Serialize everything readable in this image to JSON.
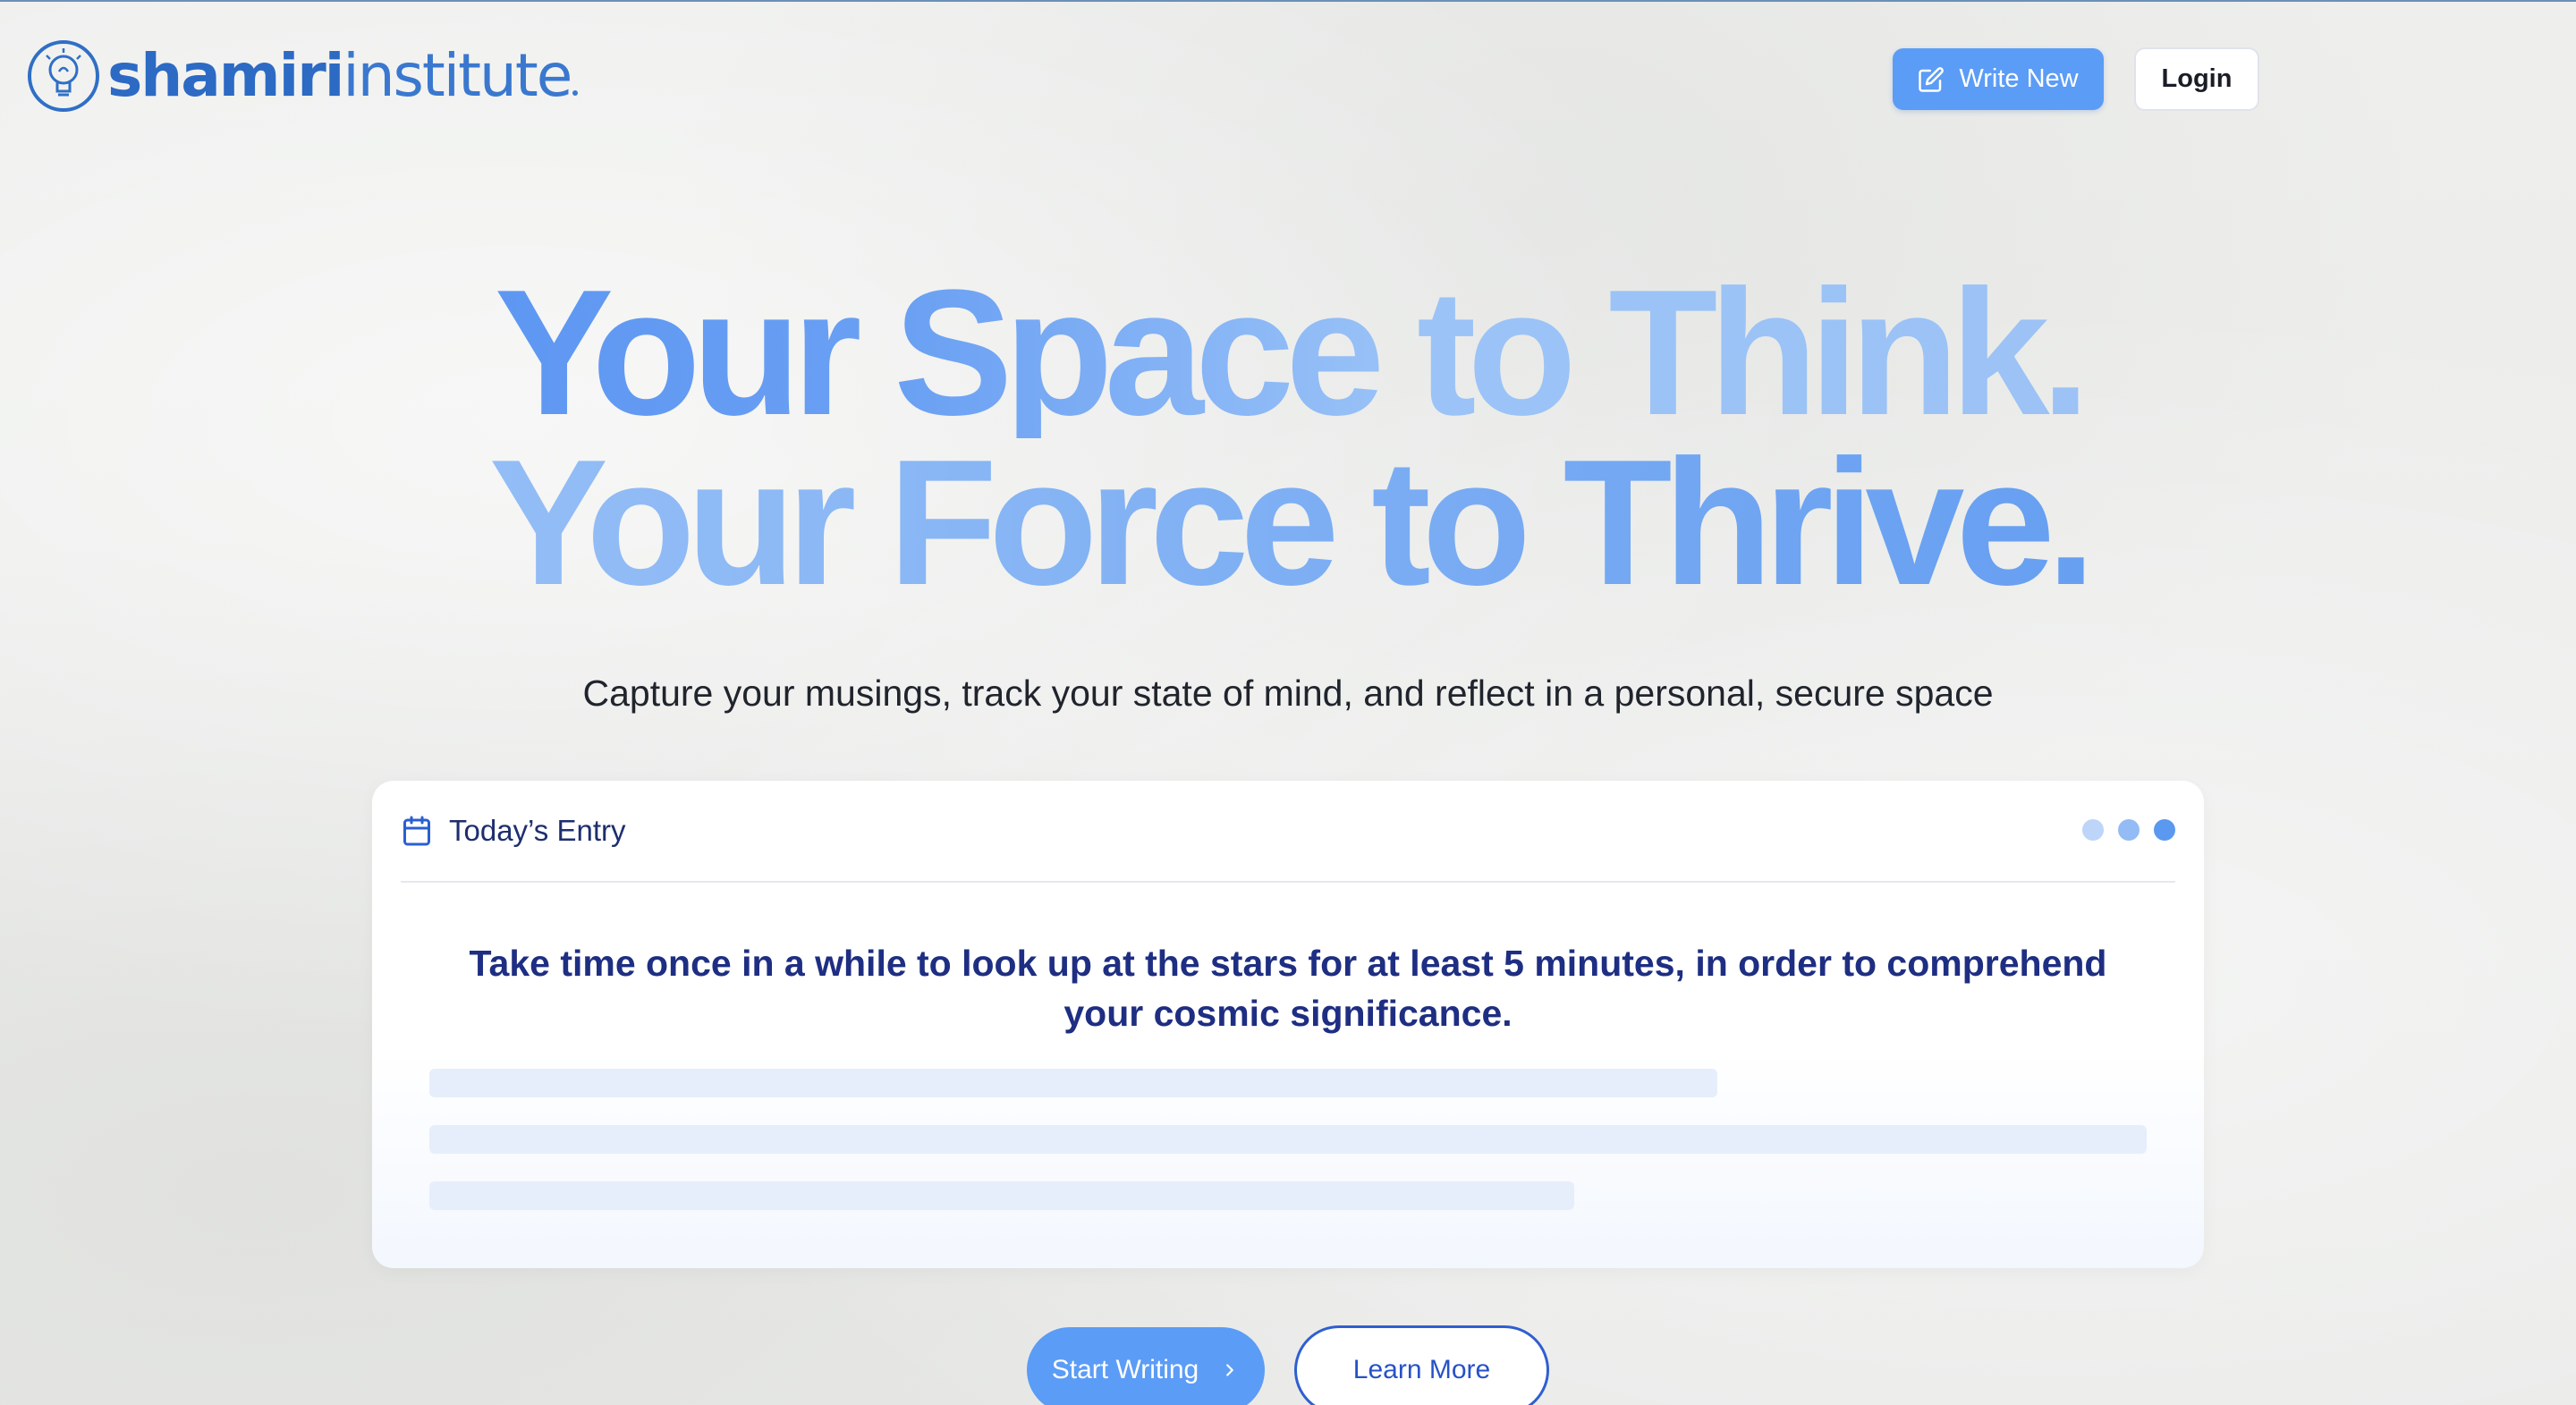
{
  "header": {
    "logo_bold": "shamiri",
    "logo_light": "institute",
    "write_new_label": "Write New",
    "login_label": "Login"
  },
  "hero": {
    "line1": "Your Space to Think.",
    "line2": "Your Force to Thrive.",
    "subtitle": "Capture your musings, track your state of mind, and reflect in a personal, secure space"
  },
  "entry_card": {
    "title": "Today’s Entry",
    "quote": "Take time once in a while to look up at the stars for at least 5 minutes, in order to comprehend your cosmic significance."
  },
  "cta": {
    "start_label": "Start Writing",
    "learn_label": "Learn More"
  },
  "colors": {
    "accent": "#5b9cf6",
    "brand_text": "#2f6fc6",
    "card_title": "#1e2e6e",
    "quote_text": "#1e2e82",
    "learn_border": "#2f5fd0"
  },
  "icons": {
    "logo": "lightbulb-head-icon",
    "write_new": "edit-pencil-icon",
    "entry": "calendar-icon",
    "start": "chevron-right-icon"
  }
}
